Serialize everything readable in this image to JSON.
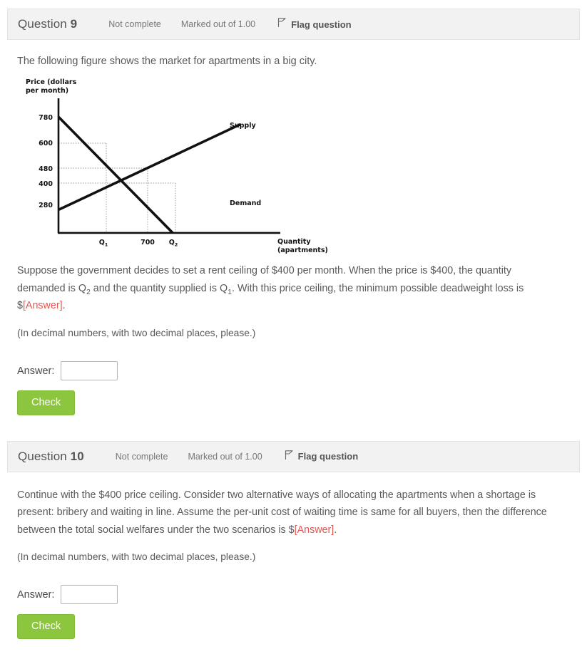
{
  "questions": [
    {
      "title_prefix": "Question",
      "number": "9",
      "state": "Not complete",
      "marked": "Marked out of 1.00",
      "flag_label": "Flag question",
      "flag_icon": "flag-icon",
      "intro": "The following figure shows the market for apartments in a big city.",
      "body_pre": "Suppose the government decides to set a rent ceiling of $400 per month. When the price is $400, the quantity demanded is Q",
      "body_sub1": "2",
      "body_mid": " and the quantity supplied is Q",
      "body_sub2": "1",
      "body_post": ". With this price ceiling, the minimum possible deadweight loss is $",
      "answer_tag": "[Answer]",
      "body_end": ".",
      "note": "(In decimal numbers, with two decimal places, please.)",
      "answer_label": "Answer:",
      "answer_value": "",
      "answer_placeholder": "",
      "check_label": "Check"
    },
    {
      "title_prefix": "Question",
      "number": "10",
      "state": "Not complete",
      "marked": "Marked out of 1.00",
      "flag_label": "Flag question",
      "flag_icon": "flag-icon",
      "body_pre": "Continue with the $400 price ceiling. Consider two alternative ways of allocating the apartments when a shortage is present: bribery and waiting in line. Assume the per-unit cost of waiting time is same for all buyers, then the difference between the total social welfares under the two scenarios is $",
      "answer_tag": "[Answer]",
      "body_end": ".",
      "note": "(In decimal numbers, with two decimal places, please.)",
      "answer_label": "Answer:",
      "answer_value": "",
      "answer_placeholder": "",
      "check_label": "Check"
    }
  ],
  "colors": {
    "check_button": "#8cc63e",
    "answer_tag": "#e8554e",
    "header_bg": "#f2f2f2",
    "header_border": "#e3e3e3",
    "text": "#58595b",
    "curve": "#111111"
  },
  "chart_data": {
    "type": "line",
    "title": "",
    "ylabel_line1": "Price (dollars",
    "ylabel_line2": "per month)",
    "xlabel_line1": "Quantity",
    "xlabel_line2": "(apartments)",
    "ytick_labels": [
      "780",
      "600",
      "480",
      "400",
      "280"
    ],
    "ytick_values": [
      780,
      600,
      480,
      400,
      280
    ],
    "xtick_labels": [
      "Q₁",
      "700",
      "Q₂"
    ],
    "xtick_main": [
      "Q",
      "700",
      "Q"
    ],
    "xtick_subs": [
      "1",
      "",
      "2"
    ],
    "xtick_values": [
      450,
      700,
      850
    ],
    "legend": [
      "Supply",
      "Demand"
    ],
    "series": [
      {
        "name": "Demand",
        "points": [
          [
            0,
            780
          ],
          [
            1100,
            280
          ]
        ],
        "label_x": 1125,
        "label_y": 295
      },
      {
        "name": "Supply",
        "points": [
          [
            0,
            280
          ],
          [
            1150,
            660
          ]
        ],
        "label_x": 1060,
        "label_y": 700
      }
    ],
    "equilibrium": {
      "quantity": 700,
      "price": 480
    },
    "guides": [
      {
        "price": 600,
        "quantity": 450,
        "label": "Q₁ at P=600"
      },
      {
        "price": 480,
        "quantity": 700,
        "label": "equilibrium"
      },
      {
        "price": 400,
        "quantity": 850,
        "label": "Q₂ at P=400"
      }
    ],
    "grid": "dotted-guides-only",
    "legend_position": "inline-right"
  }
}
